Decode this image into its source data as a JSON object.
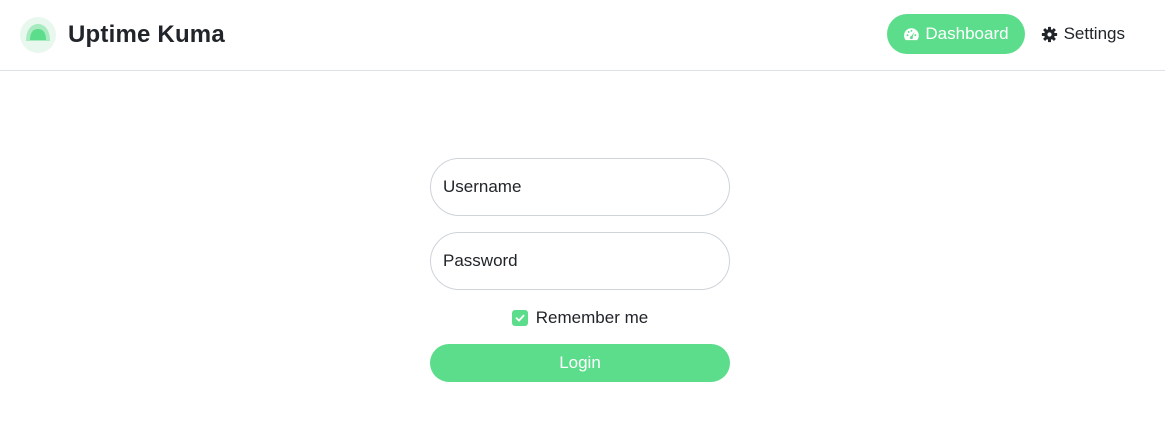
{
  "app": {
    "title": "Uptime Kuma",
    "logo_icon": "uptime-kuma-logo",
    "accent_color": "#5cdd8b"
  },
  "nav": {
    "dashboard": {
      "label": "Dashboard",
      "icon": "tachometer-icon",
      "active": true
    },
    "settings": {
      "label": "Settings",
      "icon": "gear-icon",
      "active": false
    }
  },
  "login": {
    "username_placeholder": "Username",
    "username_value": "",
    "password_placeholder": "Password",
    "password_value": "",
    "remember_label": "Remember me",
    "remember_checked": true,
    "submit_label": "Login"
  }
}
